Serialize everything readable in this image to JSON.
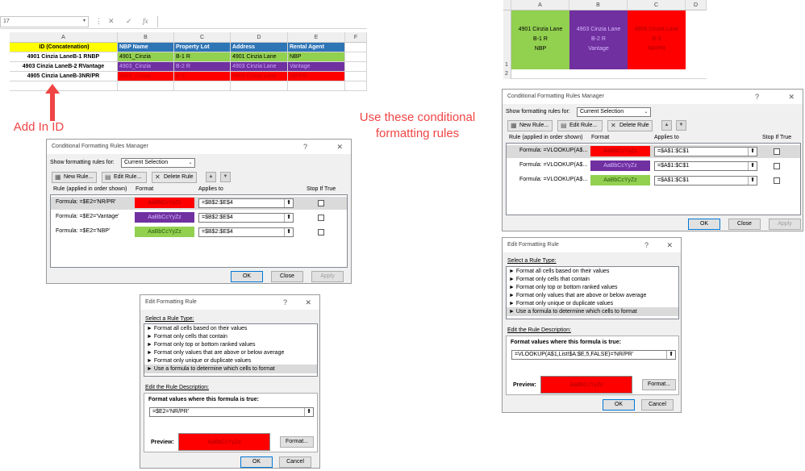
{
  "left_sheet": {
    "name_box": "17",
    "formula_icons": {
      "cancel": "✕",
      "enter": "✓",
      "fx": "fx"
    },
    "col_headers": [
      "A",
      "B",
      "C",
      "D",
      "E",
      "F"
    ],
    "headers": [
      "ID (Concatenation)",
      "NBP Name",
      "Property Lot",
      "Address",
      "Rental Agent"
    ],
    "rows": [
      [
        "4901 Cinzia LaneB-1 RNBP",
        "4901_Cinzia",
        "B-1 R",
        "4901 Cinzia Lane",
        "NBP"
      ],
      [
        "4903 Cinzia LaneB-2 RVantage",
        "4903_Cinzia",
        "B-2 R",
        "4903 Cinzia Lane",
        "Vantage"
      ],
      [
        "4905 Cinzia LaneB-3NR/PR",
        "4905_Cinzia",
        "B-3",
        "4905 Cinzia Lane",
        "NR/PR"
      ]
    ]
  },
  "annotations": {
    "add_in_id": "Add In ID",
    "use_rules_line1": "Use these conditional",
    "use_rules_line2": "formatting rules"
  },
  "cfrm_left": {
    "title": "Conditional Formatting Rules Manager",
    "show_label": "Show formatting rules for:",
    "show_value": "Current Selection",
    "new_rule": "New Rule...",
    "edit_rule": "Edit Rule...",
    "delete_rule": "Delete Rule",
    "col_rule": "Rule (applied in order shown)",
    "col_format": "Format",
    "col_applies": "Applies to",
    "col_stop": "Stop If True",
    "rules": [
      {
        "rule": "Formula: =$E2='NR/PR'",
        "format": "AaBbCcYyZz",
        "applies": "=$B$2:$E$4"
      },
      {
        "rule": "Formula: =$E2='Vantage'",
        "format": "AaBbCcYyZz",
        "applies": "=$B$2:$E$4"
      },
      {
        "rule": "Formula: =$E2='NBP'",
        "format": "AaBbCcYyZz",
        "applies": "=$B$2:$E$4"
      }
    ],
    "ok": "OK",
    "close": "Close",
    "apply": "Apply"
  },
  "efr_left": {
    "title": "Edit Formatting Rule",
    "select_type": "Select a Rule Type:",
    "types": [
      "► Format all cells based on their values",
      "► Format only cells that contain",
      "► Format only top or bottom ranked values",
      "► Format only values that are above or below average",
      "► Format only unique or duplicate values",
      "► Use a formula to determine which cells to format"
    ],
    "edit_desc": "Edit the Rule Description:",
    "format_values": "Format values where this formula is true:",
    "formula": "=$E2='NR/PR'",
    "preview": "Preview:",
    "preview_text": "AaBbCcYyZz",
    "format_btn": "Format...",
    "ok": "OK",
    "cancel": "Cancel"
  },
  "right_sheet": {
    "col_headers": [
      "A",
      "B",
      "C",
      "D"
    ],
    "row_headers": [
      "1",
      "2"
    ],
    "cells": [
      {
        "l1": "4901 Cinzia Lane",
        "l2": "B-1 R",
        "l3": "NBP"
      },
      {
        "l1": "4903 Cinzia Lane",
        "l2": "B-2 R",
        "l3": "Vantage"
      },
      {
        "l1": "4905 Cinzia Lane",
        "l2": "B-3",
        "l3": "NR/PR"
      }
    ]
  },
  "cfrm_right": {
    "title": "Conditional Formatting Rules Manager",
    "show_label": "Show formatting rules for:",
    "show_value": "Current Selection",
    "new_rule": "New Rule...",
    "edit_rule": "Edit Rule...",
    "delete_rule": "Delete Rule",
    "col_rule": "Rule (applied in order shown)",
    "col_format": "Format",
    "col_applies": "Applies to",
    "col_stop": "Stop If True",
    "rules": [
      {
        "rule": "Formula: =VLOOKUP(A$...",
        "format": "AaBbCcYyZz",
        "applies": "=$A$1:$C$1"
      },
      {
        "rule": "Formula: =VLOOKUP(A$...",
        "format": "AaBbCcYyZz",
        "applies": "=$A$1:$C$1"
      },
      {
        "rule": "Formula: =VLOOKUP(A$...",
        "format": "AaBbCcYyZz",
        "applies": "=$A$1:$C$1"
      }
    ],
    "ok": "OK",
    "close": "Close",
    "apply": "Apply"
  },
  "efr_right": {
    "title": "Edit Formatting Rule",
    "select_type": "Select a Rule Type:",
    "types": [
      "► Format all cells based on their values",
      "► Format only cells that contain",
      "► Format only top or bottom ranked values",
      "► Format only values that are above or below average",
      "► Format only unique or duplicate values",
      "► Use a formula to determine which cells to format"
    ],
    "edit_desc": "Edit the Rule Description:",
    "format_values": "Format values where this formula is true:",
    "formula": "=VLOOKUP(A$1,List!$A:$E,5,FALSE)='NR/PR'",
    "preview": "Preview:",
    "preview_text": "AaBbCcYyZz",
    "format_btn": "Format...",
    "ok": "OK",
    "cancel": "Cancel"
  }
}
